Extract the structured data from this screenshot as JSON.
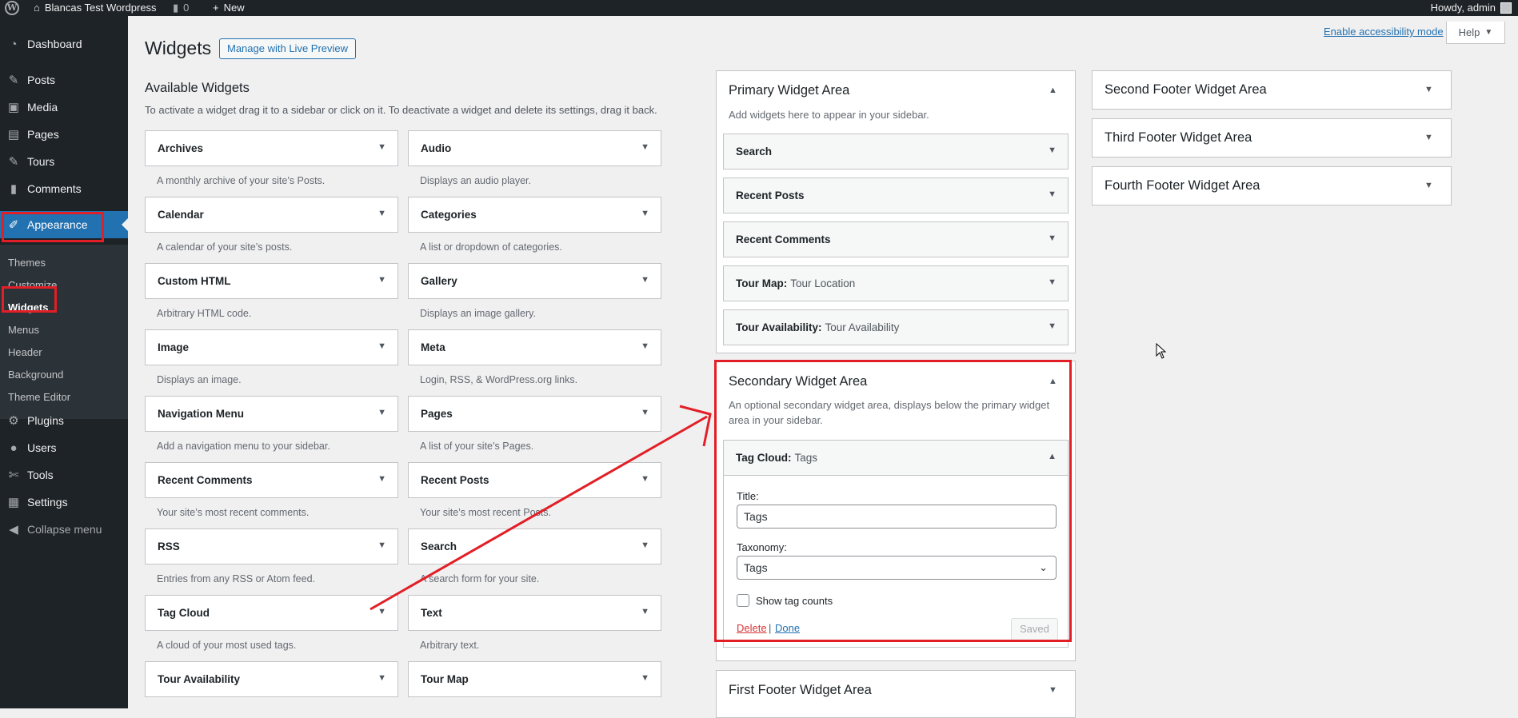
{
  "admin_bar": {
    "site_name": "Blancas Test Wordpress",
    "comments_count": "0",
    "new_label": "New",
    "howdy": "Howdy, admin"
  },
  "sidebar": {
    "items": [
      {
        "label": "Dashboard",
        "icon": "dashboard-icon"
      },
      {
        "label": "Posts",
        "icon": "pin-icon"
      },
      {
        "label": "Media",
        "icon": "media-icon"
      },
      {
        "label": "Pages",
        "icon": "pages-icon"
      },
      {
        "label": "Tours",
        "icon": "pin-icon"
      },
      {
        "label": "Comments",
        "icon": "comment-icon"
      },
      {
        "label": "Appearance",
        "icon": "brush-icon"
      },
      {
        "label": "Plugins",
        "icon": "plugin-icon"
      },
      {
        "label": "Users",
        "icon": "user-icon"
      },
      {
        "label": "Tools",
        "icon": "wrench-icon"
      },
      {
        "label": "Settings",
        "icon": "settings-icon"
      },
      {
        "label": "Collapse menu",
        "icon": "collapse-icon"
      }
    ],
    "submenu": [
      "Themes",
      "Customize",
      "Widgets",
      "Menus",
      "Header",
      "Background",
      "Theme Editor"
    ]
  },
  "header": {
    "title": "Widgets",
    "live_preview": "Manage with Live Preview",
    "accessibility": "Enable accessibility mode",
    "help": "Help"
  },
  "available": {
    "title": "Available Widgets",
    "description": "To activate a widget drag it to a sidebar or click on it. To deactivate a widget and delete its settings, drag it back.",
    "widgets": [
      {
        "name": "Archives",
        "desc": "A monthly archive of your site’s Posts."
      },
      {
        "name": "Audio",
        "desc": "Displays an audio player."
      },
      {
        "name": "Calendar",
        "desc": "A calendar of your site’s posts."
      },
      {
        "name": "Categories",
        "desc": "A list or dropdown of categories."
      },
      {
        "name": "Custom HTML",
        "desc": "Arbitrary HTML code."
      },
      {
        "name": "Gallery",
        "desc": "Displays an image gallery."
      },
      {
        "name": "Image",
        "desc": "Displays an image."
      },
      {
        "name": "Meta",
        "desc": "Login, RSS, & WordPress.org links."
      },
      {
        "name": "Navigation Menu",
        "desc": "Add a navigation menu to your sidebar."
      },
      {
        "name": "Pages",
        "desc": "A list of your site’s Pages."
      },
      {
        "name": "Recent Comments",
        "desc": "Your site’s most recent comments."
      },
      {
        "name": "Recent Posts",
        "desc": "Your site’s most recent Posts."
      },
      {
        "name": "RSS",
        "desc": "Entries from any RSS or Atom feed."
      },
      {
        "name": "Search",
        "desc": "A search form for your site."
      },
      {
        "name": "Tag Cloud",
        "desc": "A cloud of your most used tags."
      },
      {
        "name": "Text",
        "desc": "Arbitrary text."
      },
      {
        "name": "Tour Availability",
        "desc": ""
      },
      {
        "name": "Tour Map",
        "desc": ""
      }
    ]
  },
  "primary": {
    "title": "Primary Widget Area",
    "description": "Add widgets here to appear in your sidebar.",
    "widgets": [
      {
        "name": "Search",
        "instance": ""
      },
      {
        "name": "Recent Posts",
        "instance": ""
      },
      {
        "name": "Recent Comments",
        "instance": ""
      },
      {
        "name": "Tour Map:",
        "instance": "Tour Location"
      },
      {
        "name": "Tour Availability:",
        "instance": "Tour Availability"
      }
    ]
  },
  "secondary": {
    "title": "Secondary Widget Area",
    "description_line1": "An optional secondary widget area, displays below the primary widget",
    "description_line2": "area in your sidebar.",
    "widget_name": "Tag Cloud:",
    "widget_instance": "Tags",
    "title_label": "Title:",
    "title_value": "Tags",
    "taxonomy_label": "Taxonomy:",
    "taxonomy_value": "Tags",
    "show_counts_label": "Show tag counts",
    "delete": "Delete",
    "separator": "|",
    "done": "Done",
    "saved": "Saved"
  },
  "first_footer": {
    "title": "First Footer Widget Area"
  },
  "other_areas": [
    {
      "title": "Second Footer Widget Area"
    },
    {
      "title": "Third Footer Widget Area"
    },
    {
      "title": "Fourth Footer Widget Area"
    }
  ],
  "colors": {
    "highlight": "#e21f26",
    "accent": "#2271b1",
    "sidebar_bg": "#1d2327"
  }
}
